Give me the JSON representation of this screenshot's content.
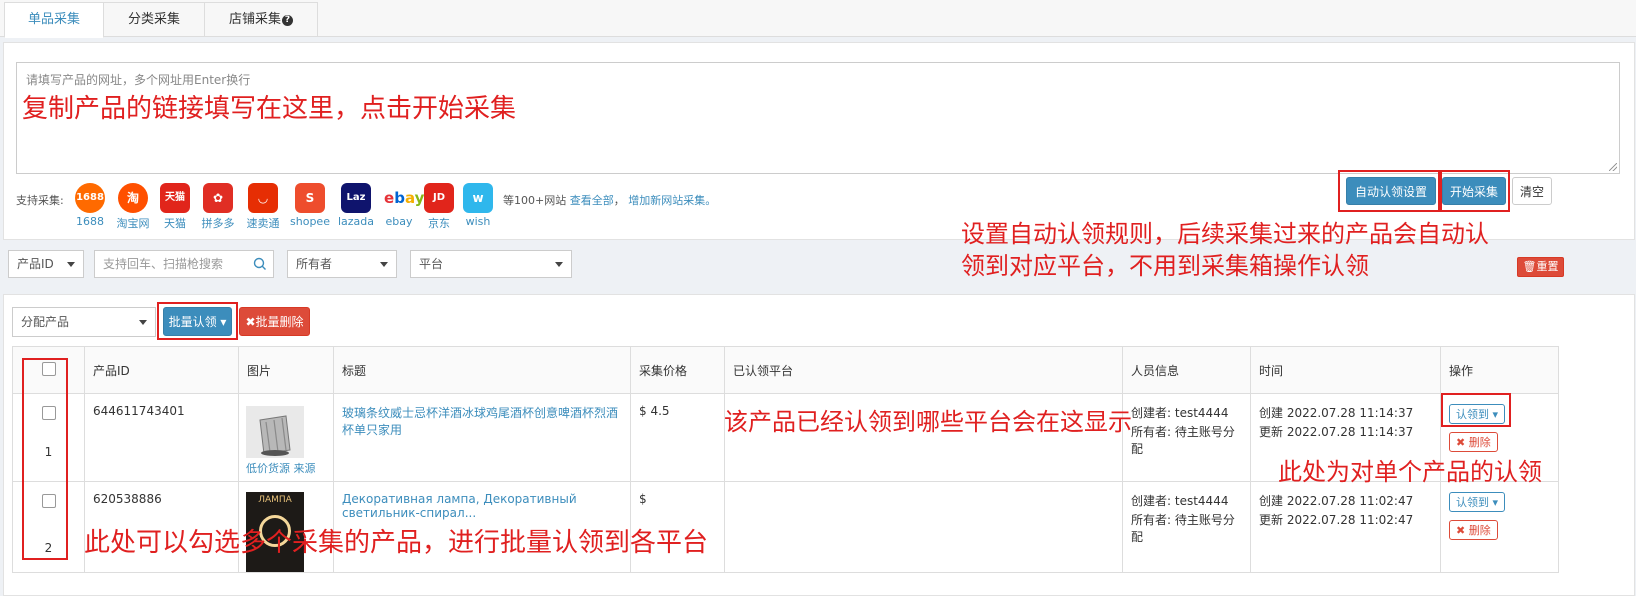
{
  "tabs": [
    {
      "label": "单品采集"
    },
    {
      "label": "分类采集"
    },
    {
      "label": "店铺采集"
    }
  ],
  "collect": {
    "placeholder": "请填写产品的网址，多个网址用Enter换行",
    "support_label": "支持采集:",
    "platforms": [
      {
        "name": "1688",
        "icon": "1688-logo",
        "color": "#ff6a00"
      },
      {
        "name": "淘宝网",
        "icon": "taobao-logo",
        "color": "#ff5000"
      },
      {
        "name": "天猫",
        "icon": "tmall-logo",
        "color": "#e1251b"
      },
      {
        "name": "拼多多",
        "icon": "pinduoduo-logo",
        "color": "#e02e24"
      },
      {
        "name": "速卖通",
        "icon": "aliexpress-logo",
        "color": "#e62e04"
      },
      {
        "name": "shopee",
        "icon": "shopee-logo",
        "color": "#ee4d2d"
      },
      {
        "name": "lazada",
        "icon": "lazada-logo",
        "color": "#0f146d"
      },
      {
        "name": "ebay",
        "icon": "ebay-logo",
        "color": "#ffffff"
      },
      {
        "name": "京东",
        "icon": "jd-logo",
        "color": "#e1251b"
      },
      {
        "name": "wish",
        "icon": "wish-logo",
        "color": "#2fb7ec"
      }
    ],
    "more_text": "等100+网站",
    "view_all": "查看全部",
    "comma": "，",
    "add_site": "增加新网站采集。",
    "auto_claim_button": "自动认领设置",
    "start_button": "开始采集",
    "clear_button": "清空"
  },
  "filters": {
    "product_id": "产品ID",
    "search_placeholder": "支持回车、扫描枪搜索",
    "owner": "所有者",
    "platform": "平台",
    "reset": "重置"
  },
  "actions": {
    "assign": "分配产品",
    "batch_claim": "批量认领",
    "batch_delete": "批量删除"
  },
  "table": {
    "headers": [
      "",
      "产品ID",
      "图片",
      "标题",
      "采集价格",
      "已认领平台",
      "人员信息",
      "时间",
      "操作"
    ],
    "rows": [
      {
        "index": "1",
        "id": "644611743401",
        "img_links": [
          "低价货源",
          "来源"
        ],
        "title": "玻璃条纹威士忌杯洋酒冰球鸡尾酒杯创意啤酒杯烈酒杯单只家用",
        "price": "$ 4.5",
        "creator_label": "创建者:",
        "creator": "test4444",
        "owner_label": "所有者:",
        "owner": "待主账号分配",
        "created": "创建 2022.07.28 11:14:37",
        "updated": "更新 2022.07.28 11:14:37",
        "claim_btn": "认领到",
        "delete_btn": "删除"
      },
      {
        "index": "2",
        "id": "620538886",
        "img_text": "ЛАМПА",
        "title": "Декоративная лампа, Декоративный светильник-спирал...",
        "price": "$",
        "creator_label": "创建者:",
        "creator": "test4444",
        "owner_label": "所有者:",
        "owner": "待主账号分配",
        "created": "创建 2022.07.28 11:02:47",
        "updated": "更新 2022.07.28 11:02:47",
        "claim_btn": "认领到",
        "delete_btn": "删除"
      }
    ]
  },
  "annotations": {
    "a1": "复制产品的链接填写在这里，点击开始采集",
    "a2_line1": "设置自动认领规则，后续采集过来的产品会自动认",
    "a2_line2": "领到对应平台，不用到采集箱操作认领",
    "a3": "该产品已经认领到哪些平台会在这显示",
    "a4": "此处为对单个产品的认领",
    "a5": "此处可以勾选多个采集的产品，进行批量认领到各平台"
  }
}
